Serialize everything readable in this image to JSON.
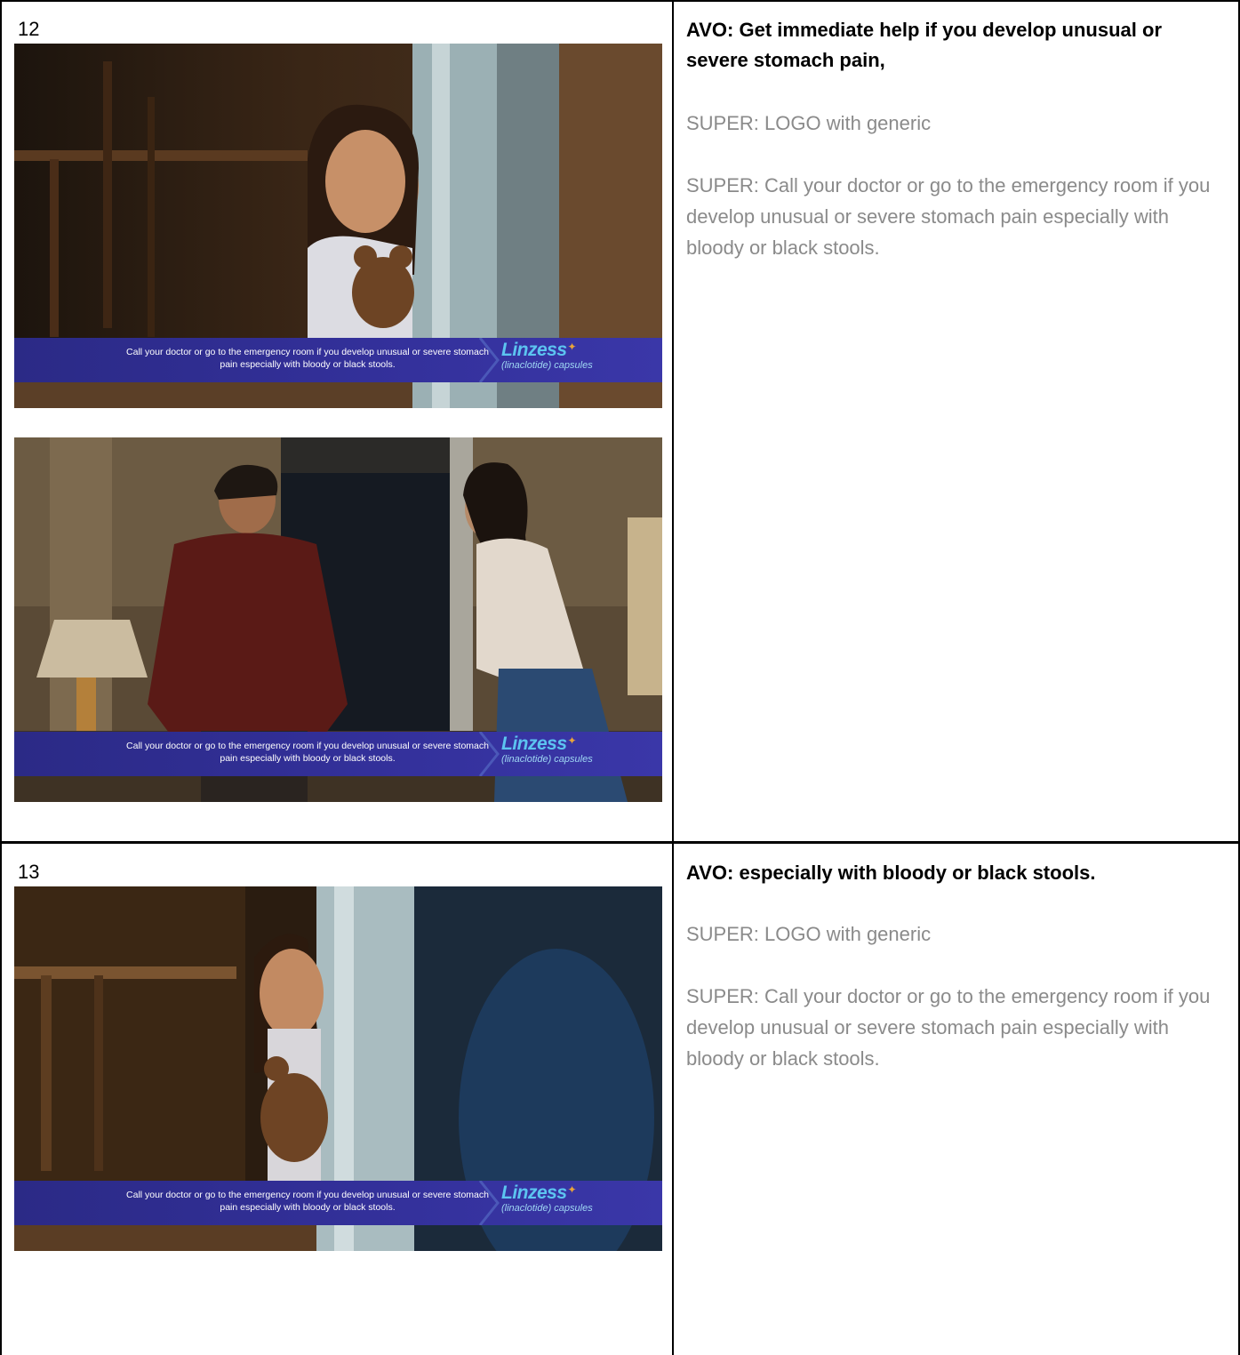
{
  "rows": [
    {
      "number": "12",
      "frames": [
        {
          "scene": "girl-with-teddy-at-door",
          "super": {
            "text": "Call your doctor or go to the emergency room if you develop unusual or severe stomach pain especially with bloody or black stools.",
            "brand_name": "Linzess",
            "brand_generic": "(linaclotide) capsules"
          }
        },
        {
          "scene": "man-and-woman-in-hallway",
          "super": {
            "text": "Call your doctor or go to the emergency room if you develop unusual or severe stomach pain especially with bloody or black stools.",
            "brand_name": "Linzess",
            "brand_generic": "(linaclotide) capsules"
          }
        }
      ],
      "avo": "AVO: Get immediate help if you develop unusual or severe stomach pain,",
      "supers": [
        "SUPER: LOGO with generic",
        "SUPER: Call your doctor or go to the emergency room if you develop unusual or severe stomach pain especially with bloody or black stools."
      ]
    },
    {
      "number": "13",
      "frames": [
        {
          "scene": "girl-smiling-behind-door",
          "super": {
            "text": "Call your doctor or go to the emergency room if you develop unusual or severe stomach pain especially with bloody or black stools.",
            "brand_name": "Linzess",
            "brand_generic": "(linaclotide) capsules"
          }
        }
      ],
      "avo": "AVO: especially with bloody or black stools.",
      "supers": [
        "SUPER: LOGO with generic",
        "SUPER: Call your doctor or go to the emergency room if you develop unusual or severe stomach pain especially with bloody or black stools."
      ]
    }
  ],
  "colors": {
    "border": "#000000",
    "super_text": "#8a8a8a",
    "bar": "#2f2d92",
    "brand": "#5cc4f0"
  }
}
